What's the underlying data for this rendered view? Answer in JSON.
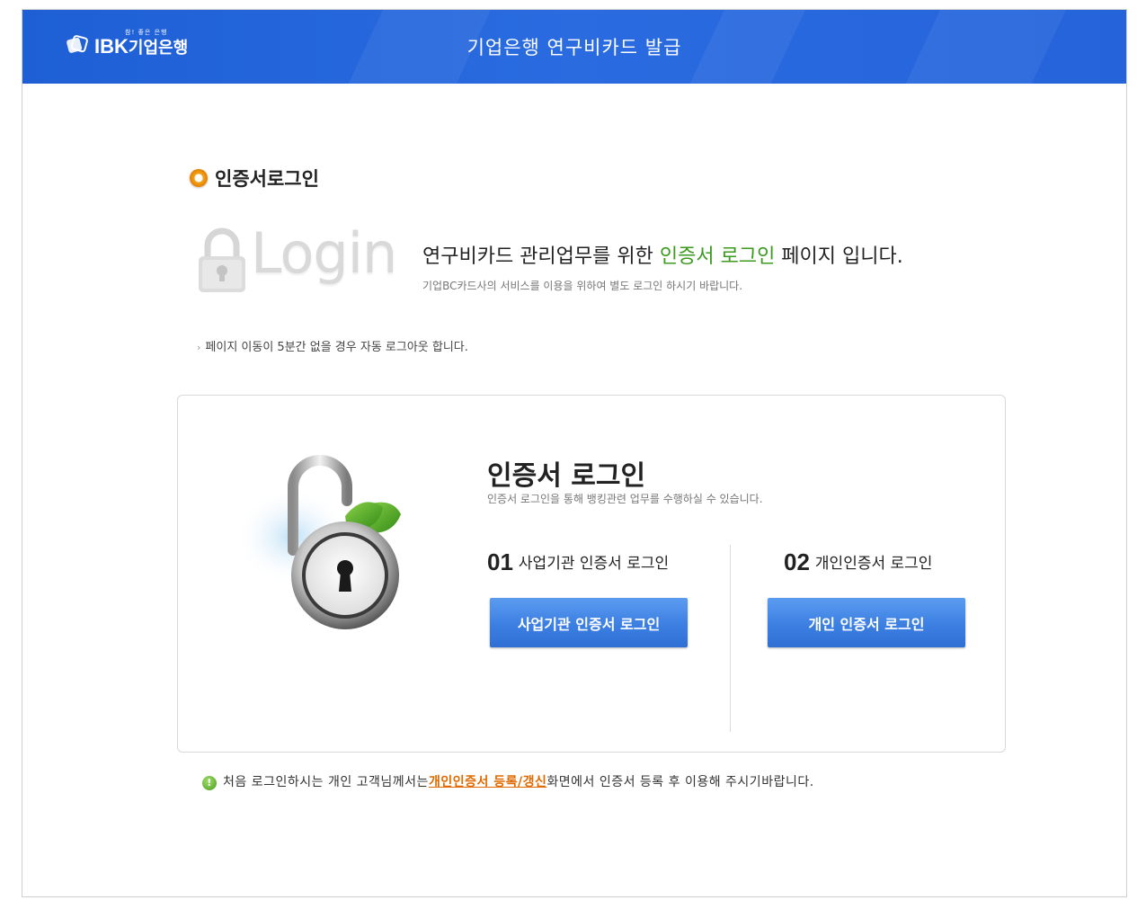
{
  "header": {
    "logo_tagline": "참! 좋은 은행",
    "logo_name": "IBK",
    "logo_name_kr": "기업은행",
    "title": "기업은행 연구비카드 발급"
  },
  "section": {
    "title": "인증서로그인"
  },
  "intro": {
    "graphic_word": "Login",
    "main_before": "연구비카드 관리업무를 위한 ",
    "main_highlight": "인증서 로그인",
    "main_after": " 페이지 입니다.",
    "sub": "기업BC카드사의 서비스를 이용을 위하여 별도 로그인 하시기 바랍니다."
  },
  "notice": "페이지 이동이 5분간 없을 경우 자동 로그아웃 합니다.",
  "card": {
    "title": "인증서 로그인",
    "desc": "인증서 로그인을 통해 뱅킹관련 업무를 수행하실 수 있습니다.",
    "options": [
      {
        "num": "01",
        "label": "사업기관 인증서 로그인",
        "button": "사업기관 인증서 로그인"
      },
      {
        "num": "02",
        "label": "개인인증서 로그인",
        "button": "개인 인증서 로그인"
      }
    ]
  },
  "footer": {
    "before": "처음 로그인하시는 개인 고객님께서는 ",
    "link": "개인인증서 등록/갱신",
    "after": "화면에서 인증서 등록 후 이용해 주시기바랍니다."
  },
  "colors": {
    "header_blue": "#2a6be0",
    "highlight_green": "#3a9b1e",
    "link_orange": "#e06a00",
    "button_blue": "#3c7fe2"
  },
  "icons": {
    "logo": "ibk-logo-icon",
    "section_bullet": "orange-dot-icon",
    "login_lock": "padlock-icon",
    "card_art": "open-padlock-leaf-icon",
    "footer_info": "info-icon"
  }
}
